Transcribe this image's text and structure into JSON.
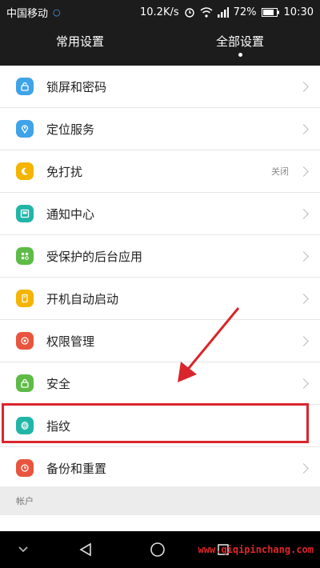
{
  "status_bar": {
    "carrier": "中国移动",
    "speed": "10.2K/s",
    "battery_percent": "72%",
    "time": "10:30"
  },
  "tabs": [
    {
      "label": "常用设置",
      "active": false
    },
    {
      "label": "全部设置",
      "active": true
    }
  ],
  "settings": [
    {
      "label": "锁屏和密码",
      "icon": "lock-icon",
      "color": "#3fa3e8"
    },
    {
      "label": "定位服务",
      "icon": "location-icon",
      "color": "#3fa3e8"
    },
    {
      "label": "免打扰",
      "icon": "moon-icon",
      "color": "#f4b400",
      "value": "关闭"
    },
    {
      "label": "通知中心",
      "icon": "notification-icon",
      "color": "#21b5a7"
    },
    {
      "label": "受保护的后台应用",
      "icon": "protected-apps-icon",
      "color": "#5dbb46"
    },
    {
      "label": "开机自动启动",
      "icon": "startup-icon",
      "color": "#f4b400"
    },
    {
      "label": "权限管理",
      "icon": "permission-icon",
      "color": "#e8553e"
    },
    {
      "label": "安全",
      "icon": "shield-icon",
      "color": "#5dbb46"
    },
    {
      "label": "指纹",
      "icon": "fingerprint-icon",
      "color": "#21b5a7"
    },
    {
      "label": "备份和重置",
      "icon": "backup-icon",
      "color": "#e8553e"
    }
  ],
  "section_header": "帐户",
  "watermark": "www.qiqipinchang.com",
  "colors": {
    "highlight": "#d9262c",
    "annotation_arrow": "#d9262c"
  }
}
